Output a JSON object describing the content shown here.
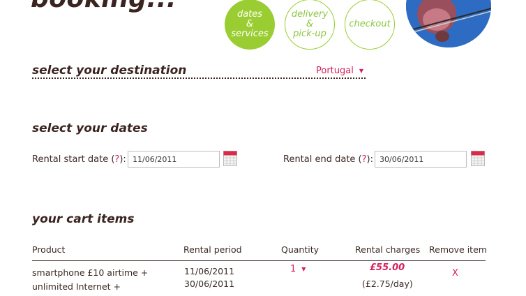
{
  "header": {
    "title": "booking...",
    "steps": [
      {
        "label": "dates\n&\nservices",
        "state": "active"
      },
      {
        "label": "delivery\n&\npick-up",
        "state": "inactive"
      },
      {
        "label": "checkout",
        "state": "inactive"
      }
    ]
  },
  "destination": {
    "heading": "select your destination",
    "selected": "Portugal"
  },
  "dates": {
    "heading": "select your dates",
    "start": {
      "label_before": "Rental start date (",
      "help": "?",
      "label_after": "):",
      "value": "11/06/2011"
    },
    "end": {
      "label_before": "Rental end date (",
      "help": "?",
      "label_after": "):",
      "value": "30/06/2011"
    }
  },
  "cart": {
    "heading": "your cart items",
    "columns": [
      "Product",
      "Rental period",
      "Quantity",
      "Rental charges",
      "Remove item"
    ],
    "rows": [
      {
        "product_line1": "smartphone £10 airtime +",
        "product_line2": "unlimited Internet +",
        "period_start": "11/06/2011",
        "period_end": "30/06/2011",
        "quantity": "1",
        "charge": "£55.00",
        "per_day": "(£2.75/day)",
        "remove": "X"
      }
    ]
  },
  "colors": {
    "accent_green": "#9acd32",
    "accent_pink": "#d51f5d",
    "text_brown": "#3a2420"
  }
}
